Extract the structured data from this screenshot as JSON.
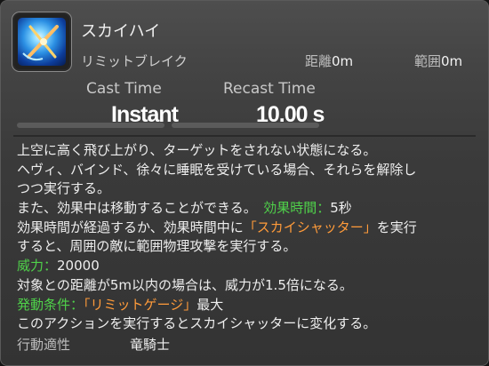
{
  "action": {
    "name": "スカイハイ",
    "type": "リミットブレイク",
    "range_label": "距離",
    "range_value": "0m",
    "radius_label": "範囲",
    "radius_value": "0m",
    "icon": "skyhigh-action-icon"
  },
  "timing": {
    "cast_label": "Cast Time",
    "cast_value": "Instant",
    "recast_label": "Recast Time",
    "recast_value": "10.00 s"
  },
  "description": {
    "l1": "上空に高く飛び上がり、ターゲットをされない状態になる。",
    "l2": "ヘヴィ、バインド、徐々に睡眠を受けている場合、それらを解除し",
    "l3": "つつ実行する。",
    "l4a": "また、効果中は移動することができる。　",
    "l4k": "効果時間：",
    "l4v": "5秒",
    "l5": "効果時間が経過するか、効果時間中に",
    "l5h": "「スカイシャッター」",
    "l5b": "を実行",
    "l6": "すると、周囲の敵に範囲物理攻撃を実行する。",
    "potency_label": "威力：",
    "potency_value": "20000",
    "l8": "対象との距離が5m以内の場合は、威力が1.5倍になる。",
    "cond_label": "発動条件：",
    "cond_value": "「リミットゲージ」",
    "cond_suffix": "最大",
    "l10": "このアクションを実行するとスカイシャッターに変化する。"
  },
  "footer": {
    "job_label": "行動適性",
    "job_value": "竜騎士"
  },
  "colors": {
    "highlight_green": "#4fd14a",
    "highlight_orange": "#ff9b3a"
  }
}
